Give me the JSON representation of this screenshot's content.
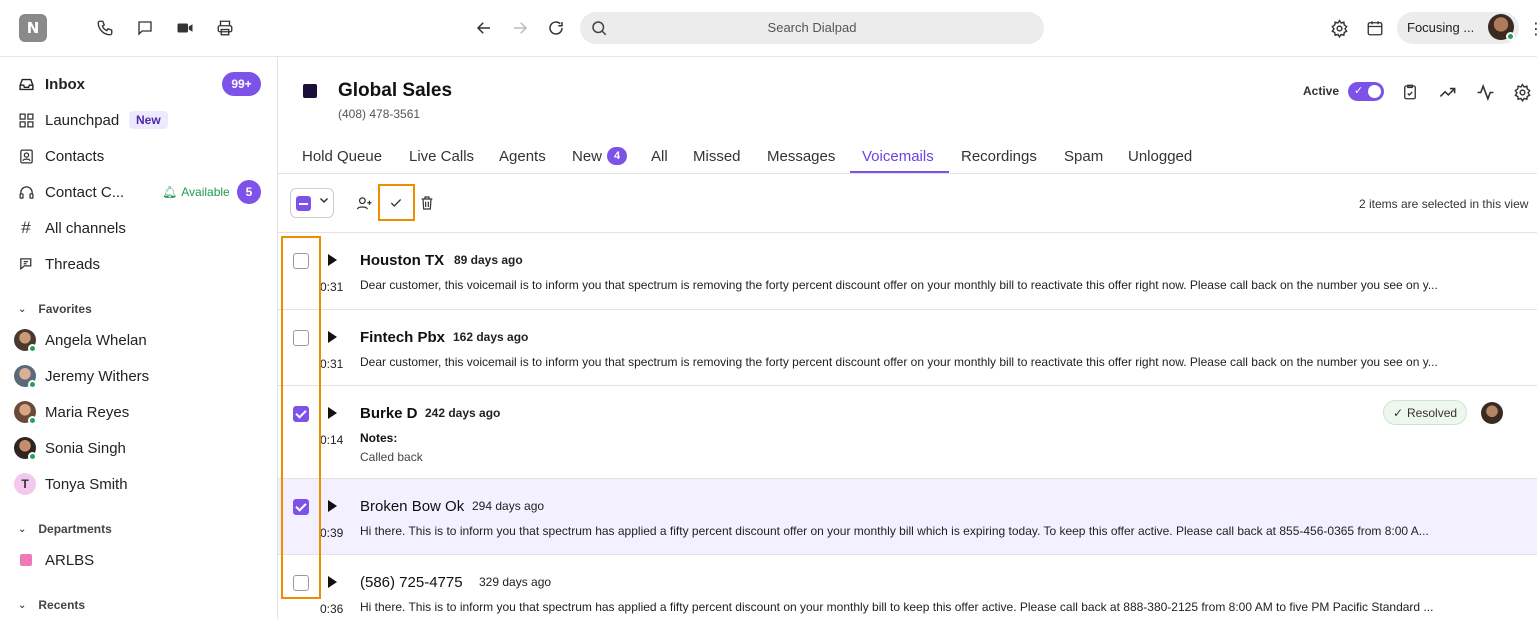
{
  "topbar": {
    "logo_text": "N",
    "search_placeholder": "Search Dialpad",
    "focus_label": "Focusing ..."
  },
  "sidebar": {
    "inbox": {
      "label": "Inbox",
      "badge": "99+"
    },
    "launchpad": {
      "label": "Launchpad",
      "tag": "New"
    },
    "contacts": {
      "label": "Contacts"
    },
    "contact_center": {
      "label": "Contact C...",
      "status": "Available",
      "badge": "5"
    },
    "all_channels": {
      "label": "All channels"
    },
    "threads": {
      "label": "Threads"
    },
    "favorites_heading": "Favorites",
    "favorites": [
      "Angela Whelan",
      "Jeremy Withers",
      "Maria Reyes",
      "Sonia Singh",
      "Tonya Smith"
    ],
    "tonya_initial": "T",
    "departments_heading": "Departments",
    "departments": [
      "ARLBS"
    ],
    "recents_heading": "Recents"
  },
  "header": {
    "title": "Global Sales",
    "phone": "(408) 478-3561",
    "active_label": "Active"
  },
  "tabs": [
    {
      "label": "Hold Queue"
    },
    {
      "label": "Live Calls"
    },
    {
      "label": "Agents"
    },
    {
      "label": "New",
      "badge": "4"
    },
    {
      "label": "All"
    },
    {
      "label": "Missed"
    },
    {
      "label": "Messages"
    },
    {
      "label": "Voicemails",
      "active": true
    },
    {
      "label": "Recordings"
    },
    {
      "label": "Spam"
    },
    {
      "label": "Unlogged"
    }
  ],
  "toolbar": {
    "selection_info": "2 items are selected in this view"
  },
  "voicemails": [
    {
      "name": "Houston TX",
      "ago": "89 days ago",
      "duration": "0:31",
      "checked": false,
      "unread": true,
      "message": "Dear customer, this voicemail is to inform you that spectrum is removing the forty percent discount offer on your monthly bill to reactivate this offer right now. Please call back on the number you see on y..."
    },
    {
      "name": "Fintech Pbx",
      "ago": "162 days ago",
      "duration": "0:31",
      "checked": false,
      "unread": true,
      "message": "Dear customer, this voicemail is to inform you that spectrum is removing the forty percent discount offer on your monthly bill to reactivate this offer right now. Please call back on the number you see on y..."
    },
    {
      "name": "Burke D",
      "ago": "242 days ago",
      "duration": "0:14",
      "checked": true,
      "unread": true,
      "notes_label": "Notes:",
      "notes": "Called back",
      "status": "Resolved"
    },
    {
      "name": "Broken Bow Ok",
      "ago": "294 days ago",
      "duration": "0:39",
      "checked": true,
      "unread": false,
      "message": "Hi there. This is to inform you that spectrum has applied a fifty percent discount offer on your monthly bill which is expiring today. To keep this offer active. Please call back at 855-456-0365 from 8:00 A..."
    },
    {
      "name": "(586) 725-4775",
      "ago": "329 days ago",
      "duration": "0:36",
      "checked": false,
      "unread": false,
      "message": "Hi there. This is to inform you that spectrum has applied a fifty percent discount on your monthly bill to keep this offer active. Please call back at 888-380-2125 from 8:00 AM to five PM Pacific Standard ..."
    }
  ],
  "colors": {
    "accent": "#7c52e8",
    "highlight": "#f08c00",
    "online": "#22a35a"
  }
}
